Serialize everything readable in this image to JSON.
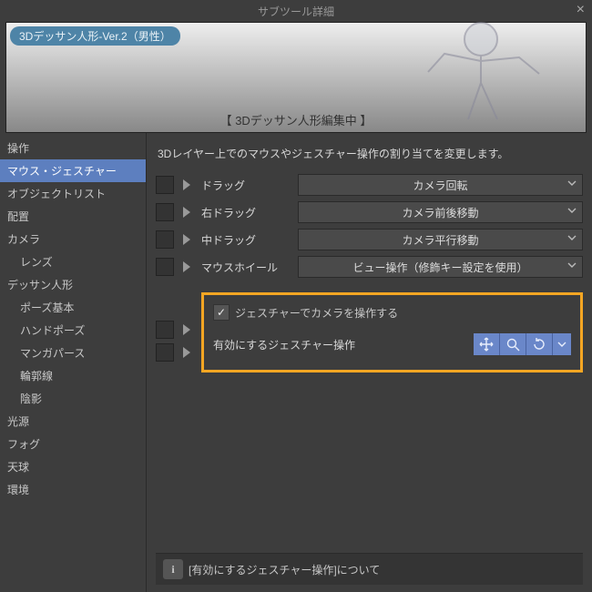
{
  "window": {
    "title": "サブツール詳細",
    "close": "×"
  },
  "preview": {
    "chip": "3Dデッサン人形-Ver.2（男性）",
    "editing": "【 3Dデッサン人形編集中 】"
  },
  "sidebar": {
    "items": [
      {
        "label": "操作",
        "indent": false,
        "sel": false
      },
      {
        "label": "マウス・ジェスチャー",
        "indent": false,
        "sel": true
      },
      {
        "label": "オブジェクトリスト",
        "indent": false,
        "sel": false
      },
      {
        "label": "配置",
        "indent": false,
        "sel": false
      },
      {
        "label": "カメラ",
        "indent": false,
        "sel": false
      },
      {
        "label": "レンズ",
        "indent": true,
        "sel": false
      },
      {
        "label": "デッサン人形",
        "indent": false,
        "sel": false
      },
      {
        "label": "ポーズ基本",
        "indent": true,
        "sel": false
      },
      {
        "label": "ハンドポーズ",
        "indent": true,
        "sel": false
      },
      {
        "label": "マンガパース",
        "indent": true,
        "sel": false
      },
      {
        "label": "輪郭線",
        "indent": true,
        "sel": false
      },
      {
        "label": "陰影",
        "indent": true,
        "sel": false
      },
      {
        "label": "光源",
        "indent": false,
        "sel": false
      },
      {
        "label": "フォグ",
        "indent": false,
        "sel": false
      },
      {
        "label": "天球",
        "indent": false,
        "sel": false
      },
      {
        "label": "環境",
        "indent": false,
        "sel": false
      }
    ]
  },
  "main": {
    "description": "3Dレイヤー上でのマウスやジェスチャー操作の割り当てを変更します。",
    "rows": [
      {
        "label": "ドラッグ",
        "value": "カメラ回転"
      },
      {
        "label": "右ドラッグ",
        "value": "カメラ前後移動"
      },
      {
        "label": "中ドラッグ",
        "value": "カメラ平行移動"
      },
      {
        "label": "マウスホイール",
        "value": "ビュー操作（修飾キー設定を使用）"
      }
    ],
    "gesture": {
      "checkbox_label": "ジェスチャーでカメラを操作する",
      "enable_label": "有効にするジェスチャー操作",
      "icons": [
        "move-icon",
        "zoom-icon",
        "rotate-icon"
      ]
    }
  },
  "info": {
    "text": "[有効にするジェスチャー操作]について"
  }
}
